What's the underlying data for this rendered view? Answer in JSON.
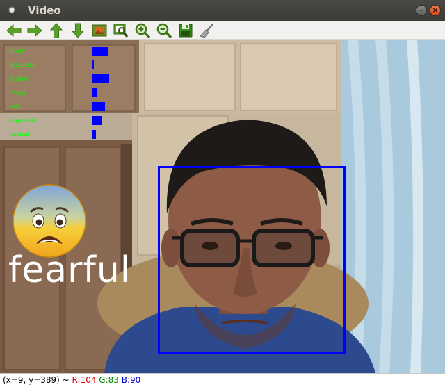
{
  "window": {
    "title": "Video"
  },
  "toolbar": {
    "buttons": [
      {
        "name": "pan-left",
        "icon": "arrow-left-icon"
      },
      {
        "name": "pan-right",
        "icon": "arrow-right-icon"
      },
      {
        "name": "pan-up",
        "icon": "arrow-up-icon"
      },
      {
        "name": "pan-down",
        "icon": "arrow-down-icon"
      },
      {
        "name": "zoom-original",
        "icon": "image-icon"
      },
      {
        "name": "zoom-fit",
        "icon": "zoom-fit-icon"
      },
      {
        "name": "zoom-in",
        "icon": "zoom-in-icon"
      },
      {
        "name": "zoom-out",
        "icon": "zoom-out-icon"
      },
      {
        "name": "save",
        "icon": "save-icon"
      },
      {
        "name": "properties",
        "icon": "brush-icon"
      }
    ]
  },
  "overlay": {
    "emotions": [
      {
        "label": "angry",
        "score": 0.24
      },
      {
        "label": "disgusted",
        "score": 0.03
      },
      {
        "label": "fearful",
        "score": 0.25
      },
      {
        "label": "happy",
        "score": 0.08
      },
      {
        "label": "sad",
        "score": 0.19
      },
      {
        "label": "surprised",
        "score": 0.14
      },
      {
        "label": "neutral",
        "score": 0.06
      }
    ],
    "detected_emotion": "fearful",
    "emoji": "fearful-face-emoji"
  },
  "status": {
    "coords": "(x=9, y=389) ~",
    "r": "R:104",
    "g": "G:83",
    "b": "B:90"
  },
  "colors": {
    "bar": "#0000ff",
    "label": "#00ff00",
    "face_box": "#0000ff"
  }
}
